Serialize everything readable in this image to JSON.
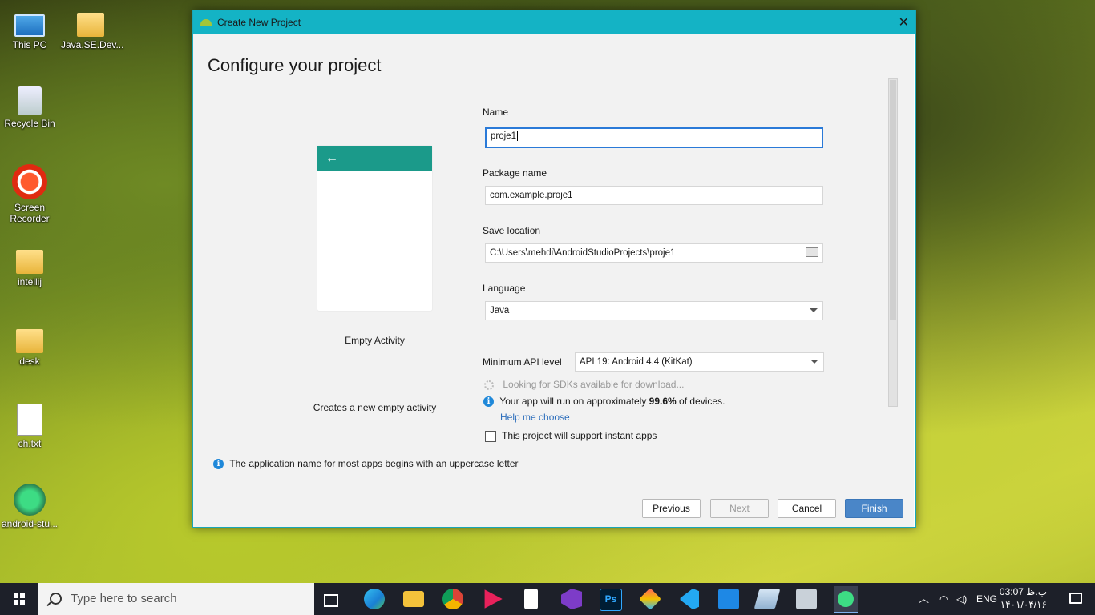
{
  "desktop": {
    "icons": [
      {
        "label": "This PC",
        "icon": "computer-icon"
      },
      {
        "label": "Java.SE.Dev...",
        "icon": "folder-icon"
      },
      {
        "label": "Recycle Bin",
        "icon": "recycle-bin-icon"
      },
      {
        "label": "Screen\nRecorder",
        "icon": "screen-recorder-icon"
      },
      {
        "label": "intellij",
        "icon": "folder-icon"
      },
      {
        "label": "desk",
        "icon": "folder-icon"
      },
      {
        "label": "ch.txt",
        "icon": "text-file-icon"
      },
      {
        "label": "android-stu...",
        "icon": "android-studio-icon"
      }
    ]
  },
  "dialog": {
    "title": "Create New Project",
    "heading": "Configure your project",
    "template": {
      "back_arrow": "←",
      "name": "Empty Activity",
      "description": "Creates a new empty activity"
    },
    "fields": {
      "name_label": "Name",
      "name_value": "proje1",
      "package_label": "Package name",
      "package_value": "com.example.proje1",
      "location_label": "Save location",
      "location_value": "C:\\Users\\mehdi\\AndroidStudioProjects\\proje1",
      "language_label": "Language",
      "language_value": "Java",
      "api_label": "Minimum API level",
      "api_value": "API 19: Android 4.4 (KitKat)"
    },
    "sdk_status": "Looking for SDKs available for download...",
    "coverage_prefix": "Your app will run on approximately ",
    "coverage_value": "99.6%",
    "coverage_suffix": " of devices.",
    "help_link": "Help me choose",
    "instant_apps_label": "This project will support instant apps",
    "info_message": "The application name for most apps begins with an uppercase letter",
    "buttons": {
      "previous": "Previous",
      "next": "Next",
      "cancel": "Cancel",
      "finish": "Finish"
    },
    "close_glyph": "✕"
  },
  "taskbar": {
    "search_placeholder": "Type here to search",
    "apps": [
      "task-view-icon",
      "edge-icon",
      "file-explorer-icon",
      "chrome-icon",
      "media-player-icon",
      "notepad-icon",
      "visual-studio-icon",
      "photoshop-icon",
      "app-icon",
      "vscode-icon",
      "vmware-icon",
      "files-icon",
      "network-icon",
      "android-studio-icon"
    ],
    "photoshop_label": "Ps",
    "tray": {
      "language": "ENG",
      "time": "03:07 ب.ظ",
      "date": "۱۴۰۱/۰۴/۱۶"
    }
  },
  "colors": {
    "titlebar": "#14b3c5",
    "accent_teal": "#1b9a8a",
    "primary_button": "#4a86c8",
    "link": "#2e6fbc"
  }
}
